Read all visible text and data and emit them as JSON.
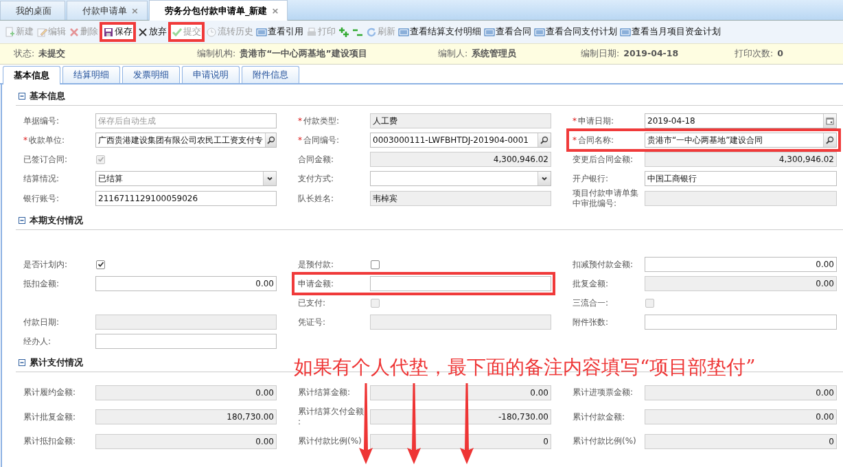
{
  "top_tabs": [
    {
      "label": "我的桌面",
      "selected": false,
      "closable": false
    },
    {
      "label": "付款申请单",
      "selected": false,
      "closable": true
    },
    {
      "label": "劳务分包付款申请单_新建",
      "selected": true,
      "closable": true
    }
  ],
  "close_glyph": "×",
  "toolbar": [
    {
      "label": "新建",
      "disabled": true,
      "highlighted": false
    },
    {
      "label": "编辑",
      "disabled": true,
      "highlighted": false
    },
    {
      "label": "删除",
      "disabled": true,
      "highlighted": false
    },
    {
      "label": "保存",
      "disabled": false,
      "highlighted": true
    },
    {
      "label": "放弃",
      "disabled": false,
      "highlighted": false
    },
    {
      "label": "提交",
      "disabled": true,
      "highlighted": true
    },
    {
      "label": "流转历史",
      "disabled": true,
      "highlighted": false
    },
    {
      "label": "查看引用",
      "disabled": false,
      "highlighted": false
    },
    {
      "label": "打印",
      "disabled": true,
      "highlighted": false
    },
    {
      "disabled": false,
      "highlighted": false
    },
    {
      "disabled": false,
      "highlighted": false
    },
    {
      "label": "刷新",
      "disabled": true,
      "highlighted": false
    },
    {
      "label": "查看结算支付明细",
      "disabled": false,
      "highlighted": false
    },
    {
      "label": "查看合同",
      "disabled": false,
      "highlighted": false
    },
    {
      "label": "查看合同支付计划",
      "disabled": false,
      "highlighted": false
    },
    {
      "label": "查看当月项目资金计划",
      "disabled": false,
      "highlighted": false
    }
  ],
  "info_bar": [
    {
      "label": "状态:",
      "value": "未提交"
    },
    {
      "label": "编制机构:",
      "value": "贵港市“一中心两基地”建设项目"
    },
    {
      "label": "编制人:",
      "value": "系统管理员"
    },
    {
      "label": "编制日期:",
      "value": "2019-04-18"
    },
    {
      "label": "打印次数:",
      "value": "0"
    }
  ],
  "sub_tabs": [
    {
      "label": "基本信息",
      "selected": true
    },
    {
      "label": "结算明细",
      "selected": false
    },
    {
      "label": "发票明细",
      "selected": false
    },
    {
      "label": "申请说明",
      "selected": false
    },
    {
      "label": "附件信息",
      "selected": false
    }
  ],
  "sections": [
    {
      "title": "基本信息",
      "expanded": true,
      "rows": [
        [
          {
            "kind": "text",
            "label": "单据编号:",
            "highlighted": false,
            "placeholder": "保存后自动生成"
          },
          {
            "kind": "text_readonly",
            "mark": "*",
            "label": "付款类型:",
            "highlighted": false,
            "value": "人工费"
          },
          {
            "kind": "date",
            "mark": "*",
            "label": "申请日期:",
            "highlighted": false,
            "value": "2019-04-18"
          }
        ],
        [
          {
            "kind": "lookup",
            "mark": "*",
            "label": "收款单位:",
            "highlighted": false,
            "value": "广西贵港建设集团有限公司农民工工资支付专"
          },
          {
            "kind": "lookup",
            "mark": "*",
            "label": "合同编号:",
            "highlighted": false,
            "value": "0003000111-LWFBHTDJ-201904-0001"
          },
          {
            "kind": "lookup",
            "mark": "*",
            "label": "合同名称:",
            "highlighted": true,
            "value": "贵港市“一中心两基地”建设合同"
          }
        ],
        [
          {
            "kind": "checkbox",
            "label": "已签订合同:",
            "highlighted": false,
            "checked": true,
            "disabled": true
          },
          {
            "kind": "amount_readonly",
            "label": "合同金额:",
            "highlighted": false,
            "value": "4,300,946.02"
          },
          {
            "kind": "amount_readonly",
            "label": "变更后合同金额:",
            "highlighted": false,
            "value": "4,300,946.02"
          }
        ],
        [
          {
            "kind": "select",
            "label": "结算情况:",
            "highlighted": false,
            "value": "已结算"
          },
          {
            "kind": "select",
            "label": "支付方式:",
            "highlighted": false
          },
          {
            "kind": "text",
            "label": "开户银行:",
            "highlighted": false,
            "value": "中国工商银行"
          }
        ],
        [
          {
            "kind": "text",
            "label": "银行账号:",
            "highlighted": false,
            "value": "2116711129100059026"
          },
          {
            "kind": "text_readonly",
            "label": "队长姓名:",
            "highlighted": false,
            "value": "韦棹宾"
          },
          {
            "kind": "text_readonly",
            "label": "项目付款申请单集中审批编号:",
            "highlighted": false
          }
        ]
      ]
    },
    {
      "title": "本期支付情况",
      "expanded": true,
      "rows": [
        [
          {
            "kind": "checkbox",
            "label": "是否计划内:",
            "highlighted": false,
            "checked": true,
            "disabled": false
          },
          {
            "kind": "checkbox",
            "label": "是预付款:",
            "highlighted": false,
            "checked": false,
            "disabled": false
          },
          {
            "kind": "amount",
            "label": "扣减预付款金额:",
            "highlighted": false,
            "value": "0.00"
          }
        ],
        [
          {
            "kind": "amount",
            "label": "抵扣金额:",
            "highlighted": false,
            "value": "0.00"
          },
          {
            "kind": "amount",
            "label": "申请金额:",
            "highlighted": true
          },
          {
            "kind": "amount_readonly",
            "label": "批复金额:",
            "highlighted": false,
            "value": "0.00"
          }
        ],
        [
          {
            "kind": "empty"
          },
          {
            "kind": "checkbox",
            "label": "已支付:",
            "highlighted": false,
            "checked": false,
            "disabled": true
          },
          {
            "kind": "checkbox",
            "label": "三流合一:",
            "highlighted": false,
            "checked": false,
            "disabled": true
          }
        ],
        [
          {
            "kind": "text_readonly",
            "label": "付款日期:",
            "highlighted": false
          },
          {
            "kind": "text_readonly",
            "label": "凭证号:",
            "highlighted": false
          },
          {
            "kind": "text",
            "label": "附件张数:",
            "highlighted": false
          }
        ],
        [
          {
            "kind": "text",
            "label": "经办人:",
            "highlighted": false
          },
          {
            "kind": "empty"
          },
          {
            "kind": "empty"
          }
        ]
      ]
    },
    {
      "title": "累计支付情况",
      "expanded": true,
      "rows": [
        [
          {
            "kind": "amount_readonly",
            "label": "累计履约金额:",
            "highlighted": false,
            "value": "0.00"
          },
          {
            "kind": "amount_readonly",
            "label": "累计结算金额:",
            "highlighted": false,
            "value": "0.00"
          },
          {
            "kind": "amount_readonly",
            "label": "累计进项票金额:",
            "highlighted": false,
            "value": "0.00"
          }
        ],
        [
          {
            "kind": "amount_readonly",
            "label": "累计批复金额:",
            "highlighted": false,
            "value": "180,730.00"
          },
          {
            "kind": "amount_readonly",
            "label": "累计结算欠付金额:",
            "highlighted": false,
            "value": "-180,730.00"
          },
          {
            "kind": "amount_readonly",
            "label": "累计付款金额:",
            "highlighted": false,
            "value": "0.00"
          }
        ],
        [
          {
            "kind": "amount_readonly",
            "label": "累计抵扣金额:",
            "highlighted": false,
            "value": "0.00"
          },
          {
            "kind": "amount_readonly",
            "label": "累计付款比例(%)",
            "highlighted": false,
            "value": "0"
          },
          {
            "kind": "amount_readonly",
            "label": "累计付款比例(%)",
            "highlighted": false,
            "value": "0"
          }
        ]
      ]
    }
  ],
  "annotation": {
    "text": "如果有个人代垫，最下面的备注内容填写“项目部垫付”"
  }
}
